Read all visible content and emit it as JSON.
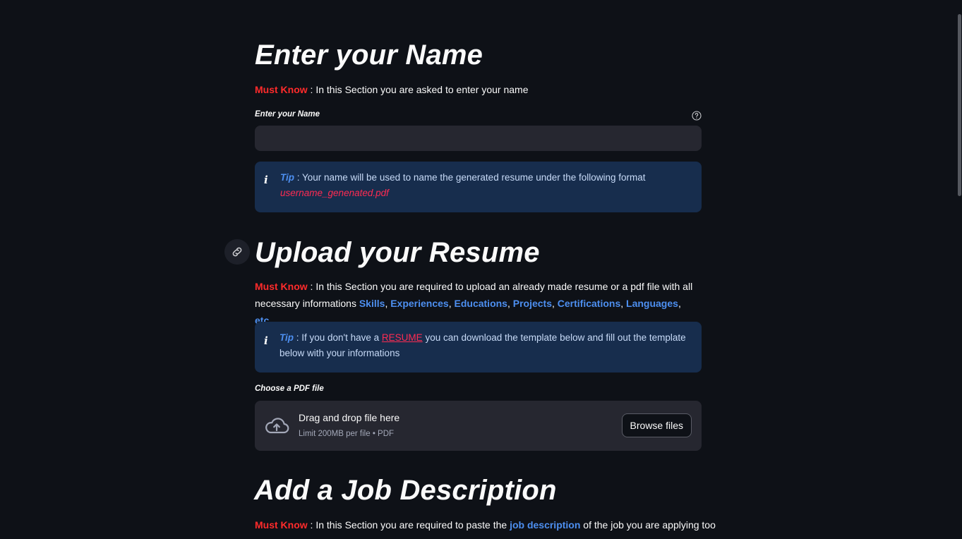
{
  "section_name": {
    "title": "Enter your Name",
    "must_know_label": "Must Know",
    "must_know_text": " : In this Section you are asked to enter your name",
    "input_label": "Enter your Name",
    "input_value": "",
    "tip_label": "Tip",
    "tip_text": " : Your name will be used to name the generated resume under the following format",
    "tip_format": "username_genenated.pdf"
  },
  "section_resume": {
    "title": "Upload your Resume",
    "must_know_label": "Must Know",
    "must_know_text": " : In this Section you are required to upload an already made resume or a pdf file with all necessary informations ",
    "highlights": [
      "Skills",
      "Experiences",
      "Educations",
      "Projects",
      "Certifications",
      "Languages",
      "etc..."
    ],
    "tip_label": "Tip",
    "tip_text_before": " : If you don't have a ",
    "tip_link": "RESUME",
    "tip_text_after": " you can download the template below and fill out the template below with your informations",
    "upload_label": "Choose a PDF file",
    "dropzone_title": "Drag and drop file here",
    "dropzone_sub": "Limit 200MB per file • PDF",
    "browse_label": "Browse files"
  },
  "section_job": {
    "title": "Add a Job Description",
    "must_know_label": "Must Know",
    "must_know_text": " : In this Section you are required to paste the ",
    "highlight": "job description",
    "must_know_text_after": " of the job you are applying too"
  },
  "icons": {
    "help": "help-circle-icon",
    "info": "info-icon",
    "upload": "cloud-upload-icon",
    "anchor": "link-icon"
  },
  "colors": {
    "background": "#0e1117",
    "must_know": "#ff2b2b",
    "highlight": "#4d8ff0",
    "info_bg": "#172d4d",
    "input_bg": "#262730"
  }
}
